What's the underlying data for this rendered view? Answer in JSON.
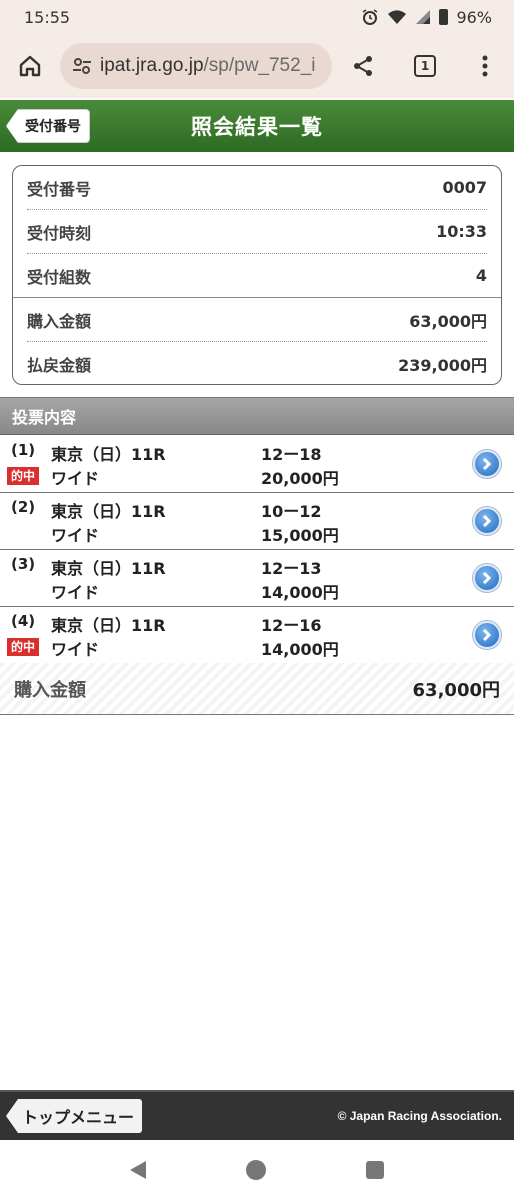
{
  "status": {
    "time": "15:55",
    "battery": "96%"
  },
  "browser": {
    "url_host": "ipat.jra.go.jp",
    "url_path": "/sp/pw_752_i",
    "tab_count": "1"
  },
  "header": {
    "back_label": "受付番号",
    "title": "照会結果一覧"
  },
  "summary": [
    {
      "label": "受付番号",
      "value": "0007"
    },
    {
      "label": "受付時刻",
      "value": "10:33"
    },
    {
      "label": "受付組数",
      "value": "4"
    },
    {
      "label": "購入金額",
      "value": "63,000円"
    },
    {
      "label": "払戻金額",
      "value": "239,000円"
    }
  ],
  "section_title": "投票内容",
  "hit_label": "的中",
  "bets": [
    {
      "no": "(1)",
      "race": "東京（日）11R",
      "type": "ワイド",
      "combo": "12ー18",
      "amount": "20,000円",
      "hit": true
    },
    {
      "no": "(2)",
      "race": "東京（日）11R",
      "type": "ワイド",
      "combo": "10ー12",
      "amount": "15,000円",
      "hit": false
    },
    {
      "no": "(3)",
      "race": "東京（日）11R",
      "type": "ワイド",
      "combo": "12ー13",
      "amount": "14,000円",
      "hit": false
    },
    {
      "no": "(4)",
      "race": "東京（日）11R",
      "type": "ワイド",
      "combo": "12ー16",
      "amount": "14,000円",
      "hit": true
    }
  ],
  "total": {
    "label": "購入金額",
    "value": "63,000円"
  },
  "footer": {
    "menu_label": "トップメニュー",
    "copyright": "© Japan Racing Association."
  },
  "colors": {
    "header_green": "#3a7a2e",
    "hit_red": "#d9302e",
    "link_blue": "#1f6bc4"
  }
}
